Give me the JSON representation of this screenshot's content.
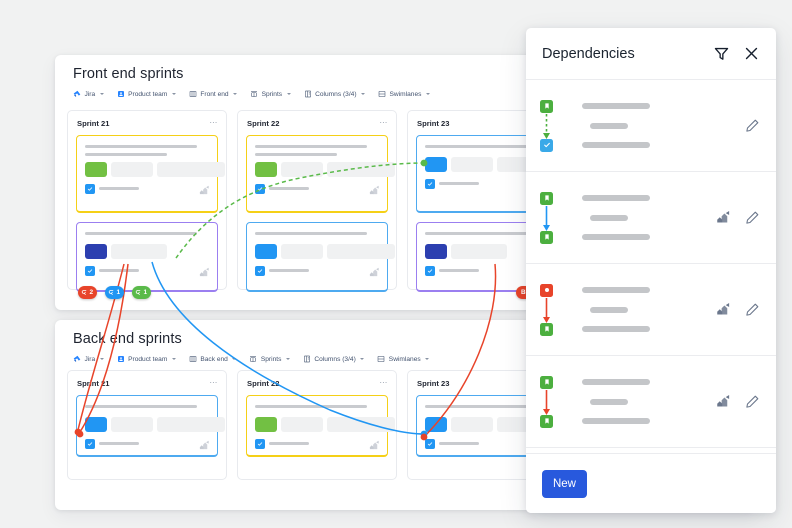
{
  "canvas": {
    "background": "#f1f2f2"
  },
  "boards": [
    {
      "id": "front-end",
      "title": "Front end sprints",
      "filters": [
        {
          "icon": "jira-icon",
          "label": "Jira"
        },
        {
          "icon": "team-icon",
          "label": "Product team"
        },
        {
          "icon": "board-icon",
          "label": "Front end"
        },
        {
          "icon": "sprints-icon",
          "label": "Sprints"
        },
        {
          "icon": "columns-icon",
          "label": "Columns (3/4)"
        },
        {
          "icon": "swimlanes-icon",
          "label": "Swimlanes"
        }
      ],
      "columns": [
        {
          "title": "Sprint 21",
          "cards": [
            {
              "border": "#f5d017",
              "chip": "#72c043",
              "chips": 3,
              "lines": 2
            },
            {
              "border": "#9b7ff0",
              "chip": "#2c3fb0",
              "chips": 2,
              "lines": 1,
              "badges": [
                {
                  "type": "blocked-by",
                  "count": "2",
                  "color": "#e8442a"
                },
                {
                  "type": "blocks",
                  "count": "1",
                  "color": "#2196f3"
                },
                {
                  "type": "relates",
                  "count": "1",
                  "color": "#5aba4a"
                }
              ]
            }
          ]
        },
        {
          "title": "Sprint 22",
          "cards": [
            {
              "border": "#f5d017",
              "chip": "#72c043",
              "chips": 3,
              "lines": 2
            },
            {
              "border": "#4eaaf0",
              "chip": "#2196f3",
              "chips": 3,
              "lines": 1
            }
          ]
        },
        {
          "title": "Sprint 23",
          "cards": [
            {
              "border": "#4eaaf0",
              "chip": "#2196f3",
              "chips": 3,
              "lines": 1
            },
            {
              "border": "#9b7ff0",
              "chip": "#2c3fb0",
              "chips": 2,
              "lines": 1,
              "blocks_label": "Blocks"
            }
          ]
        }
      ]
    },
    {
      "id": "back-end",
      "title": "Back end sprints",
      "filters": [
        {
          "icon": "jira-icon",
          "label": "Jira"
        },
        {
          "icon": "team-icon",
          "label": "Product team"
        },
        {
          "icon": "board-icon",
          "label": "Back end"
        },
        {
          "icon": "sprints-icon",
          "label": "Sprints"
        },
        {
          "icon": "columns-icon",
          "label": "Columns (3/4)"
        },
        {
          "icon": "swimlanes-icon",
          "label": "Swimlanes"
        }
      ],
      "columns": [
        {
          "title": "Sprint 21",
          "cards": [
            {
              "border": "#4eaaf0",
              "chip": "#2196f3",
              "chips": 3,
              "lines": 1
            }
          ]
        },
        {
          "title": "Sprint 22",
          "cards": [
            {
              "border": "#f5d017",
              "chip": "#72c043",
              "chips": 3,
              "lines": 1
            }
          ]
        },
        {
          "title": "Sprint 23",
          "cards": [
            {
              "border": "#4eaaf0",
              "chip": "#2196f3",
              "chips": 3,
              "lines": 1
            }
          ]
        }
      ]
    }
  ],
  "panel": {
    "title": "Dependencies",
    "filter_icon": "filter-icon",
    "close_icon": "close-icon",
    "new_label": "New",
    "rows": [
      {
        "from_icon": "story-icon",
        "from_color": "#4caf3f",
        "to_icon": "task-icon",
        "to_color": "#3aa9e8",
        "line_color": "#4caf3f",
        "line_style": "dashed",
        "jira_action": false,
        "edit_icon": "edit-pencil-icon"
      },
      {
        "from_icon": "story-icon",
        "from_color": "#4caf3f",
        "to_icon": "story-icon",
        "to_color": "#4caf3f",
        "line_color": "#2196f3",
        "line_style": "solid",
        "jira_action": true,
        "edit_icon": "edit-pencil-icon"
      },
      {
        "from_icon": "bug-icon",
        "from_color": "#e8442a",
        "to_icon": "story-icon",
        "to_color": "#4caf3f",
        "line_color": "#e8442a",
        "line_style": "solid",
        "jira_action": true,
        "edit_icon": "edit-pencil-icon"
      },
      {
        "from_icon": "story-icon",
        "from_color": "#4caf3f",
        "to_icon": "story-icon",
        "to_color": "#4caf3f",
        "line_color": "#e8442a",
        "line_style": "solid",
        "jira_action": true,
        "edit_icon": "edit-pencil-icon"
      }
    ]
  },
  "connectors": [
    {
      "name": "green-relates-link",
      "color": "#5aba4a",
      "style": "dashed"
    },
    {
      "name": "blue-blocks-link",
      "color": "#2196f3",
      "style": "solid"
    },
    {
      "name": "red-blocked-link-1",
      "color": "#e8442a",
      "style": "solid"
    },
    {
      "name": "red-blocked-link-2",
      "color": "#e8442a",
      "style": "solid"
    },
    {
      "name": "red-blocks-link-3",
      "color": "#e8442a",
      "style": "solid"
    }
  ]
}
